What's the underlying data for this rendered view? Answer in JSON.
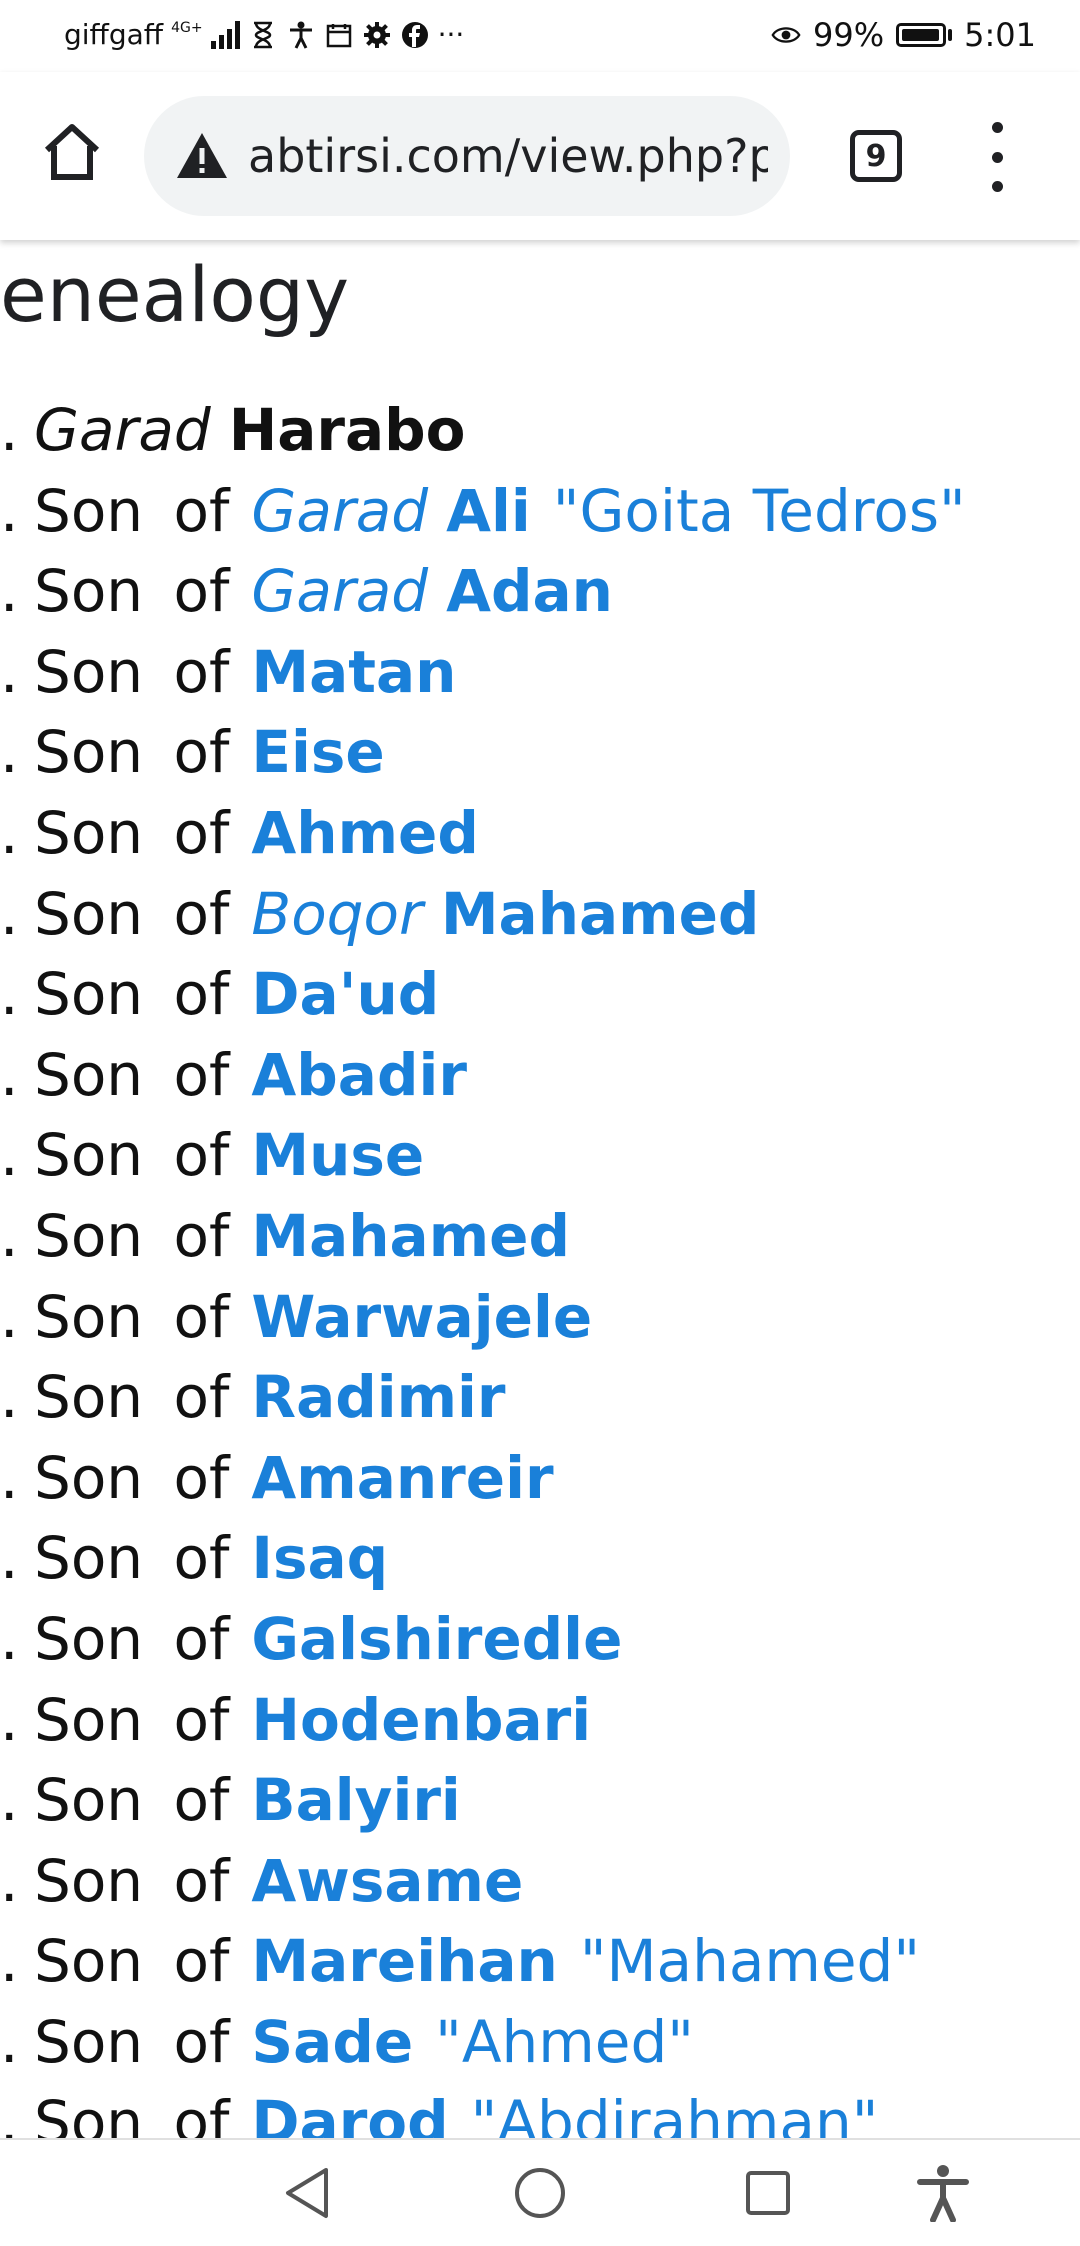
{
  "status": {
    "carrier": "giffgaff",
    "network": "4G+",
    "battery": "99%",
    "time": "5:01"
  },
  "browser": {
    "url": "abtirsi.com/view.php?pe",
    "tab_count": "9"
  },
  "page": {
    "heading": "enealogy"
  },
  "lineage": [
    {
      "prefix": "",
      "title": "Garad",
      "name": "Harabo",
      "nick": "",
      "link": false
    },
    {
      "prefix": "Son of",
      "title": "Garad",
      "name": "Ali",
      "nick": "\"Goita Tedros\"",
      "link": true
    },
    {
      "prefix": "Son of",
      "title": "Garad",
      "name": "Adan",
      "nick": "",
      "link": true
    },
    {
      "prefix": "Son of",
      "title": "",
      "name": "Matan",
      "nick": "",
      "link": true
    },
    {
      "prefix": "Son of",
      "title": "",
      "name": "Eise",
      "nick": "",
      "link": true
    },
    {
      "prefix": "Son of",
      "title": "",
      "name": "Ahmed",
      "nick": "",
      "link": true
    },
    {
      "prefix": "Son of",
      "title": "Boqor",
      "name": "Mahamed",
      "nick": "",
      "link": true
    },
    {
      "prefix": "Son of",
      "title": "",
      "name": "Da'ud",
      "nick": "",
      "link": true
    },
    {
      "prefix": "Son of",
      "title": "",
      "name": "Abadir",
      "nick": "",
      "link": true
    },
    {
      "prefix": "Son of",
      "title": "",
      "name": "Muse",
      "nick": "",
      "link": true
    },
    {
      "prefix": "Son of",
      "title": "",
      "name": "Mahamed",
      "nick": "",
      "link": true
    },
    {
      "prefix": "Son of",
      "title": "",
      "name": "Warwajele",
      "nick": "",
      "link": true
    },
    {
      "prefix": "Son of",
      "title": "",
      "name": "Radimir",
      "nick": "",
      "link": true
    },
    {
      "prefix": "Son of",
      "title": "",
      "name": "Amanreir",
      "nick": "",
      "link": true
    },
    {
      "prefix": "Son of",
      "title": "",
      "name": "Isaq",
      "nick": "",
      "link": true
    },
    {
      "prefix": "Son of",
      "title": "",
      "name": "Galshiredle",
      "nick": "",
      "link": true
    },
    {
      "prefix": "Son of",
      "title": "",
      "name": "Hodenbari",
      "nick": "",
      "link": true
    },
    {
      "prefix": "Son of",
      "title": "",
      "name": "Balyiri",
      "nick": "",
      "link": true
    },
    {
      "prefix": "Son of",
      "title": "",
      "name": "Awsame",
      "nick": "",
      "link": true
    },
    {
      "prefix": "Son of",
      "title": "",
      "name": "Mareihan",
      "nick": "\"Mahamed\"",
      "link": true
    },
    {
      "prefix": "Son of",
      "title": "",
      "name": "Sade",
      "nick": "\"Ahmed\"",
      "link": true
    },
    {
      "prefix": "Son of",
      "title": "",
      "name": "Darod",
      "nick": "\"Abdirahman\"",
      "link": true
    }
  ],
  "colors": {
    "link": "#1a80d9"
  }
}
